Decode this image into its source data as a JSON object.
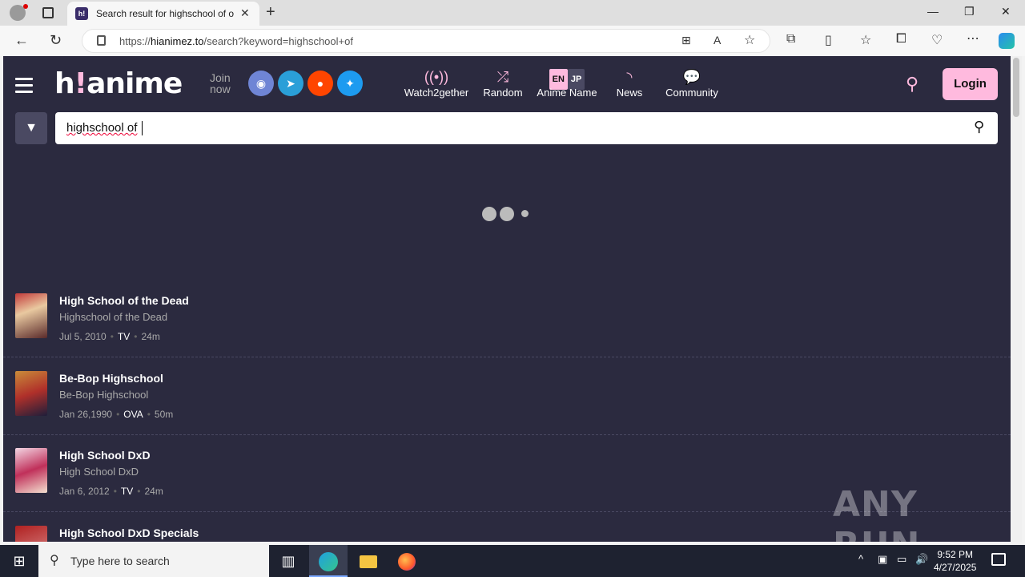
{
  "browser": {
    "tab_title": "Search result for highschool of o",
    "tab_favicon": "h!",
    "url_prefix": "https://",
    "url_domain": "hianimez.to",
    "url_path": "/search?keyword=highschool+of"
  },
  "header": {
    "logo_main": "h",
    "logo_bang": "!",
    "logo_rest": "anime",
    "join_line1": "Join",
    "join_line2": "now",
    "nav": [
      {
        "label": "Watch2gether",
        "icon": "broadcast-icon"
      },
      {
        "label": "Random",
        "icon": "shuffle-icon"
      },
      {
        "label": "Anime Name",
        "icon": "language-toggle"
      },
      {
        "label": "News",
        "icon": "rss-icon"
      },
      {
        "label": "Community",
        "icon": "chat-icon"
      }
    ],
    "lang_en": "EN",
    "lang_jp": "JP",
    "login_label": "Login"
  },
  "search": {
    "value": "highschool of"
  },
  "results": [
    {
      "title": "High School of the Dead",
      "alt_title": "Highschool of the Dead",
      "date": "Jul 5, 2010",
      "type": "TV",
      "duration": "24m"
    },
    {
      "title": "Be-Bop Highschool",
      "alt_title": "Be-Bop Highschool",
      "date": "Jan 26,1990",
      "type": "OVA",
      "duration": "50m"
    },
    {
      "title": "High School DxD",
      "alt_title": "High School DxD",
      "date": "Jan 6, 2012",
      "type": "TV",
      "duration": "24m"
    },
    {
      "title": "High School DxD Specials",
      "alt_title": "",
      "date": "",
      "type": "",
      "duration": ""
    }
  ],
  "watermark": "ANY RUN",
  "taskbar": {
    "search_placeholder": "Type here to search",
    "time": "9:52 PM",
    "date": "4/27/2025"
  }
}
